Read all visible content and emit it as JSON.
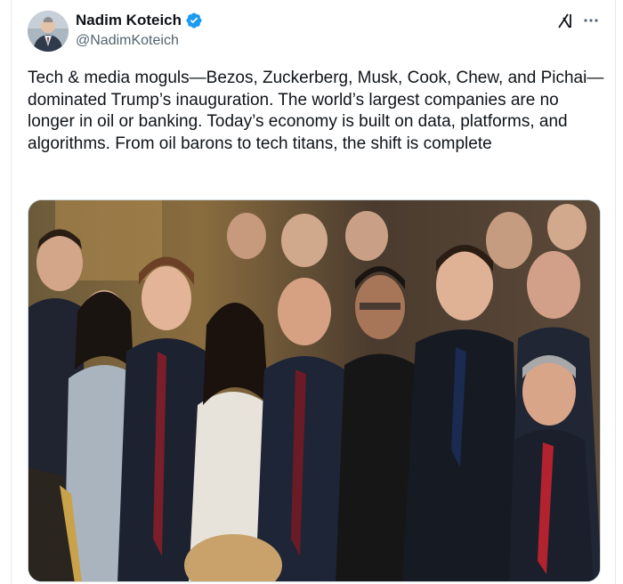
{
  "author": {
    "display_name": "Nadim Koteich",
    "handle": "@NadimKoteich",
    "verified": true,
    "verified_color": "#1d9bf0"
  },
  "header_icons": [
    "grok-icon",
    "more-icon"
  ],
  "tweet": {
    "text": "Tech & media moguls—Bezos, Zuckerberg, Musk, Cook, Chew, and Pichai—dominated Trump’s inauguration. The world’s largest companies are no longer in oil or banking. Today’s economy is built on data, platforms, and algorithms. From oil barons to tech titans, the shift is complete"
  },
  "media": {
    "kind": "photo"
  },
  "colors": {
    "text_primary": "#0f1419",
    "text_secondary": "#536471",
    "border": "#e7e9ea"
  }
}
